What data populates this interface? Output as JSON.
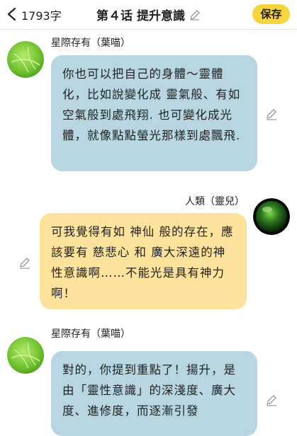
{
  "header": {
    "word_count": "1793字",
    "title": "第４话 提升意識",
    "save_label": "保存"
  },
  "messages": [
    {
      "sender": "星際存有（葉喵）",
      "side": "left",
      "text": "你也可以把自己的身體～靈體化，比如說變化成 靈氣般、有如空氣般到處飛翔. 也可變化成光體，就像點點螢光那樣到處飄飛."
    },
    {
      "sender": "人類（靈兒）",
      "side": "right",
      "text": "可我覺得有如 神仙 般的存在，應該要有 慈悲心 和 廣大深遠的神性意識啊……不能光是具有神力啊！"
    },
    {
      "sender": "星際存有（葉喵）",
      "side": "left",
      "text": "對的，你提到重點了！揚升，是由「靈性意識」的深淺度、廣大度、進修度，而逐漸引發"
    }
  ],
  "colors": {
    "left_bubble": "#b7d6e1",
    "right_bubble": "#fce29a",
    "save_button": "#f7d53e"
  },
  "icons": {
    "back": "chevron-left-icon",
    "title_edit": "pencil-icon",
    "message_edit": "pencil-icon",
    "avatar_left": "green-leaf-avatar",
    "avatar_right": "green-orb-avatar"
  }
}
